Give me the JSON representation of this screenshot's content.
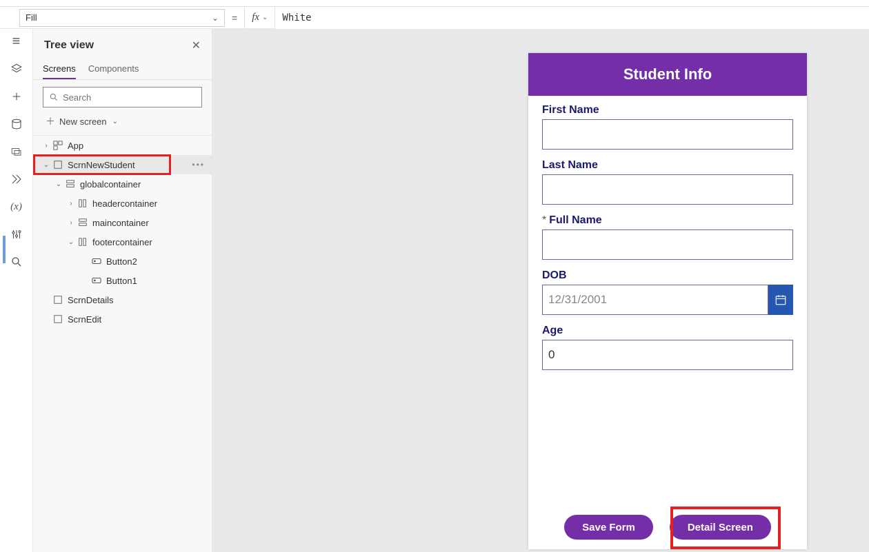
{
  "formulaBar": {
    "property": "Fill",
    "equals": "=",
    "fx": "fx",
    "value": "White"
  },
  "treeView": {
    "title": "Tree view",
    "tabs": {
      "screens": "Screens",
      "components": "Components"
    },
    "searchPlaceholder": "Search",
    "newScreen": "New screen",
    "items": {
      "app": "App",
      "scrnNew": "ScrnNewStudent",
      "global": "globalcontainer",
      "header": "headercontainer",
      "main": "maincontainer",
      "footer": "footercontainer",
      "btn2": "Button2",
      "btn1": "Button1",
      "details": "ScrnDetails",
      "edit": "ScrnEdit"
    }
  },
  "appScreen": {
    "header": "Student Info",
    "fields": {
      "firstName": {
        "label": "First Name",
        "value": ""
      },
      "lastName": {
        "label": "Last Name",
        "value": ""
      },
      "fullName": {
        "label": "Full Name",
        "required": "*",
        "value": ""
      },
      "dob": {
        "label": "DOB",
        "placeholder": "12/31/2001"
      },
      "age": {
        "label": "Age",
        "value": "0"
      }
    },
    "buttons": {
      "save": "Save Form",
      "detail": "Detail Screen"
    }
  }
}
